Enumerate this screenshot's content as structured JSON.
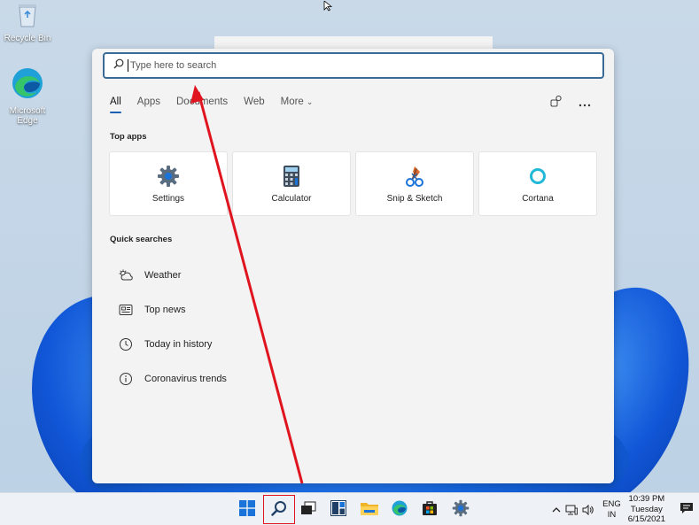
{
  "desktop": {
    "icons": [
      {
        "label": "Recycle Bin",
        "icon": "recycle-bin-icon"
      },
      {
        "label": "Microsoft Edge",
        "icon": "edge-icon"
      }
    ]
  },
  "search": {
    "placeholder": "Type here to search",
    "value": ""
  },
  "tabs": [
    {
      "label": "All",
      "active": true
    },
    {
      "label": "Apps"
    },
    {
      "label": "Documents"
    },
    {
      "label": "Web"
    },
    {
      "label": "More"
    }
  ],
  "panel_actions": [
    {
      "icon": "account-switch-icon"
    },
    {
      "icon": "more-options-icon"
    }
  ],
  "top_apps": {
    "title": "Top apps",
    "items": [
      {
        "label": "Settings",
        "icon": "settings-gear-icon"
      },
      {
        "label": "Calculator",
        "icon": "calculator-icon"
      },
      {
        "label": "Snip & Sketch",
        "icon": "snip-sketch-icon"
      },
      {
        "label": "Cortana",
        "icon": "cortana-icon"
      }
    ]
  },
  "quick_searches": {
    "title": "Quick searches",
    "items": [
      {
        "label": "Weather",
        "icon": "weather-icon"
      },
      {
        "label": "Top news",
        "icon": "news-icon"
      },
      {
        "label": "Today in history",
        "icon": "clock-icon"
      },
      {
        "label": "Coronavirus trends",
        "icon": "info-icon"
      }
    ]
  },
  "taskbar": {
    "items": [
      {
        "icon": "start-icon"
      },
      {
        "icon": "search-icon",
        "highlighted": true
      },
      {
        "icon": "task-view-icon"
      },
      {
        "icon": "widgets-icon"
      },
      {
        "icon": "file-explorer-icon"
      },
      {
        "icon": "edge-icon"
      },
      {
        "icon": "store-icon"
      },
      {
        "icon": "settings-gear-icon"
      }
    ],
    "tray": {
      "lang_line1": "ENG",
      "lang_line2": "IN",
      "time": "10:39 PM",
      "day": "Tuesday",
      "date": "6/15/2021"
    }
  },
  "colors": {
    "accent": "#1a5fb4",
    "annotation": "#e0141e",
    "panel_bg": "#f3f3f3"
  }
}
